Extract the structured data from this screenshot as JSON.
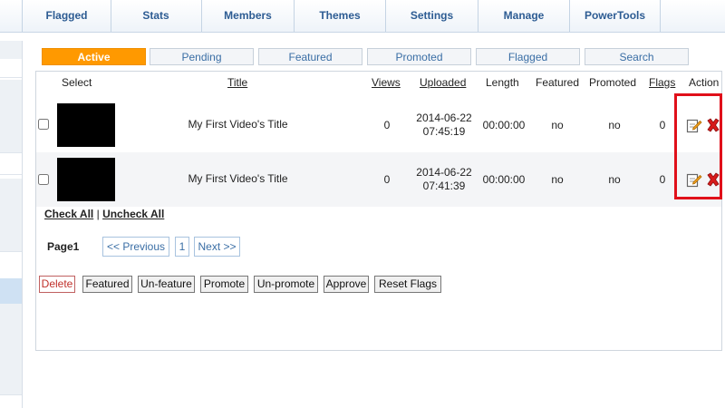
{
  "topnav": [
    "Flagged",
    "Stats",
    "Members",
    "Themes",
    "Settings",
    "Manage",
    "PowerTools"
  ],
  "subtabs": [
    "Active",
    "Pending",
    "Featured",
    "Promoted",
    "Flagged",
    "Search"
  ],
  "table": {
    "headers": {
      "select": "Select",
      "title": "Title",
      "views": "Views",
      "uploaded": "Uploaded",
      "length": "Length",
      "featured": "Featured",
      "promoted": "Promoted",
      "flags": "Flags",
      "action": "Action"
    },
    "rows": [
      {
        "title": "My First Video's Title",
        "views": "0",
        "date": "2014-06-22",
        "time": "07:45:19",
        "length": "00:00:00",
        "featured": "no",
        "promoted": "no",
        "flags": "0"
      },
      {
        "title": "My First Video's Title",
        "views": "0",
        "date": "2014-06-22",
        "time": "07:41:39",
        "length": "00:00:00",
        "featured": "no",
        "promoted": "no",
        "flags": "0"
      }
    ]
  },
  "check": {
    "all": "Check All",
    "sep": "|",
    "none": "Uncheck All"
  },
  "pager": {
    "label": "Page1",
    "prev": "<< Previous",
    "page": "1",
    "next": "Next >>"
  },
  "bulk": [
    "Delete",
    "Featured",
    "Un-feature",
    "Promote",
    "Un-promote",
    "Approve",
    "Reset Flags"
  ],
  "icons": {
    "edit": "edit-icon",
    "delete": "delete-icon"
  },
  "colors": {
    "accent": "#ff9900",
    "link": "#3a6ea5",
    "highlight": "#e0101a",
    "delete": "#c0302a"
  }
}
